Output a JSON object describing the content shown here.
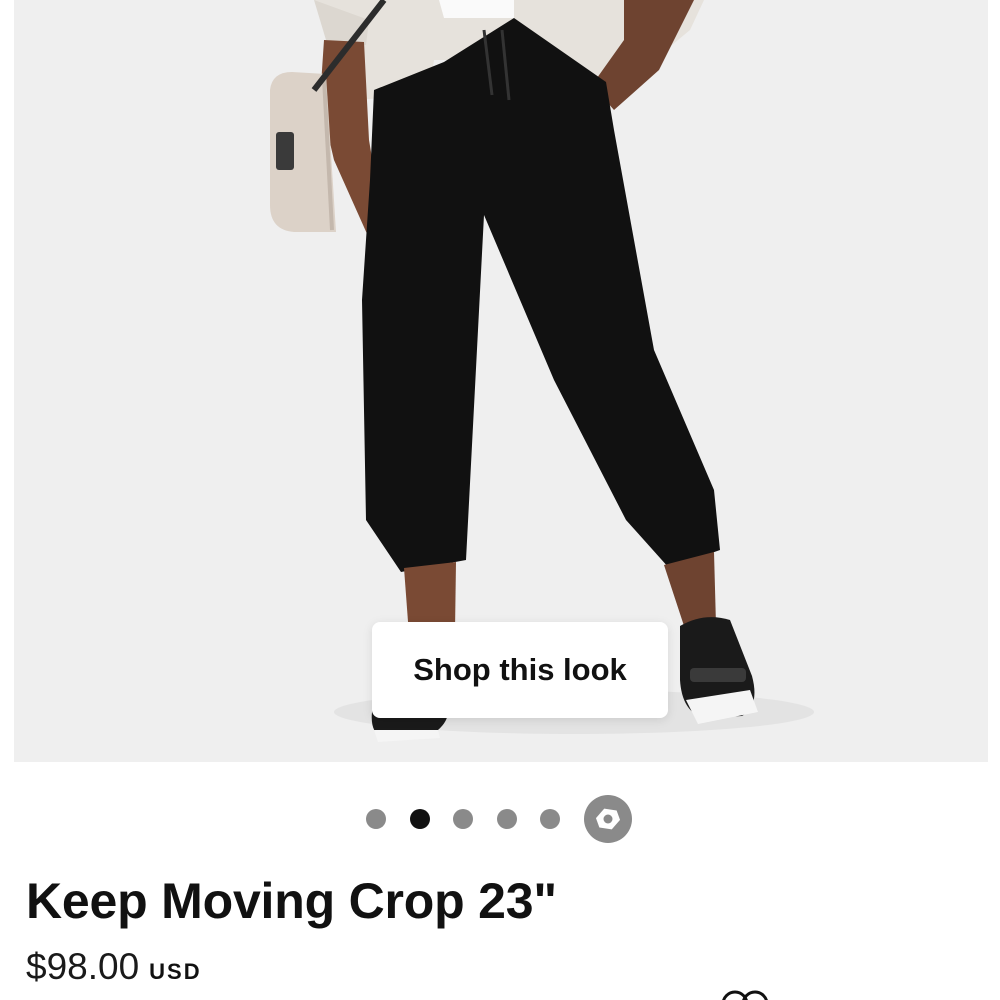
{
  "product_image": {
    "shop_button_label": "Shop this look"
  },
  "gallery": {
    "dots": [
      {
        "active": false
      },
      {
        "active": true
      },
      {
        "active": false
      },
      {
        "active": false
      },
      {
        "active": false
      }
    ],
    "last_icon": "tag-icon"
  },
  "product": {
    "title": "Keep Moving Crop 23\"",
    "price": "$98.00",
    "currency": "USD"
  },
  "colors": {
    "image_background": "#efefef",
    "pants": "#111111",
    "dot_inactive": "#8a8a8a",
    "dot_active": "#111111"
  }
}
